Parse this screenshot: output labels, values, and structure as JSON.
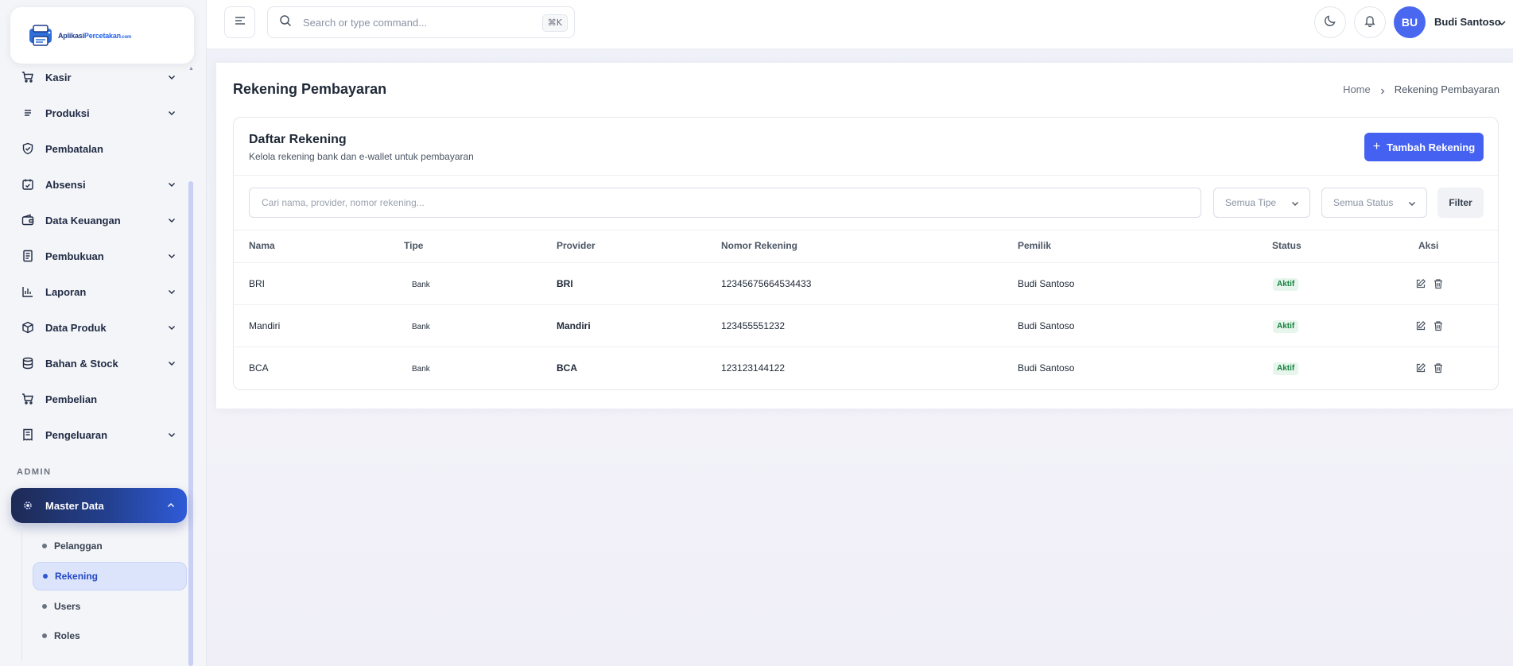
{
  "app": {
    "logo": {
      "brand": "Aplikasi",
      "brand_accent": "Percetakan",
      "domain": ".com"
    }
  },
  "sidebar": {
    "items": [
      {
        "label": "Kasir",
        "icon": "cart-icon",
        "has_chevron": true
      },
      {
        "label": "Produksi",
        "icon": "list-icon",
        "has_chevron": true
      },
      {
        "label": "Pembatalan",
        "icon": "shield-check-icon",
        "has_chevron": false
      },
      {
        "label": "Absensi",
        "icon": "calendar-check-icon",
        "has_chevron": true
      },
      {
        "label": "Data Keuangan",
        "icon": "wallet-icon",
        "has_chevron": true
      },
      {
        "label": "Pembukuan",
        "icon": "book-icon",
        "has_chevron": true
      },
      {
        "label": "Laporan",
        "icon": "bar-chart-icon",
        "has_chevron": true
      },
      {
        "label": "Data Produk",
        "icon": "box-icon",
        "has_chevron": true
      },
      {
        "label": "Bahan & Stock",
        "icon": "database-icon",
        "has_chevron": true
      },
      {
        "label": "Pembelian",
        "icon": "cart-icon",
        "has_chevron": false
      },
      {
        "label": "Pengeluaran",
        "icon": "receipt-icon",
        "has_chevron": true
      }
    ],
    "section_label": "ADMIN",
    "master_data": {
      "label": "Master Data",
      "icon": "gear-icon",
      "subitems": [
        {
          "label": "Pelanggan",
          "active": false
        },
        {
          "label": "Rekening",
          "active": true
        },
        {
          "label": "Users",
          "active": false
        },
        {
          "label": "Roles",
          "active": false
        }
      ]
    }
  },
  "topbar": {
    "search_placeholder": "Search or type command...",
    "shortcut": "⌘K",
    "user_initials": "BU",
    "user_name": "Budi Santoso"
  },
  "page": {
    "title": "Rekening Pembayaran",
    "breadcrumb": {
      "home": "Home",
      "current": "Rekening Pembayaran"
    }
  },
  "card": {
    "title": "Daftar Rekening",
    "subtitle": "Kelola rekening bank dan e-wallet untuk pembayaran",
    "add_button": "Tambah Rekening",
    "search_placeholder": "Cari nama, provider, nomor rekening...",
    "type_filter": "Semua Tipe",
    "status_filter": "Semua Status",
    "filter_button": "Filter"
  },
  "table": {
    "headers": [
      "Nama",
      "Tipe",
      "Provider",
      "Nomor Rekening",
      "Pemilik",
      "Status",
      "Aksi"
    ],
    "rows": [
      {
        "nama": "BRI",
        "tipe": "Bank",
        "provider": "BRI",
        "nomor": "12345675664534433",
        "pemilik": "Budi Santoso",
        "status": "Aktif"
      },
      {
        "nama": "Mandiri",
        "tipe": "Bank",
        "provider": "Mandiri",
        "nomor": "123455551232",
        "pemilik": "Budi Santoso",
        "status": "Aktif"
      },
      {
        "nama": "BCA",
        "tipe": "Bank",
        "provider": "BCA",
        "nomor": "123123144122",
        "pemilik": "Budi Santoso",
        "status": "Aktif"
      }
    ]
  },
  "colors": {
    "primary": "#4461f2",
    "active_sub": "#2447c2",
    "badge_bg": "#e7f6ec",
    "badge_text": "#15803d"
  }
}
